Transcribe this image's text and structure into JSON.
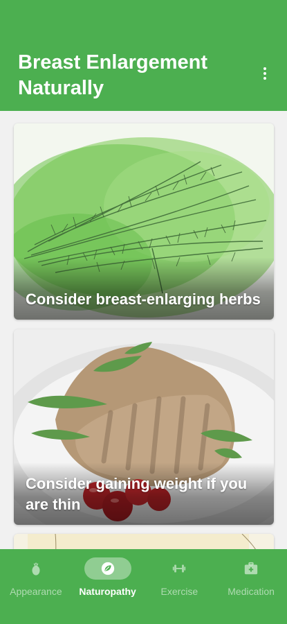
{
  "app_bar": {
    "title": "Breast Enlargement Naturally",
    "menu_icon": "more-vert-icon"
  },
  "articles": [
    {
      "title": "Consider breast-enlarging herbs",
      "image": "dill-herb-illustration"
    },
    {
      "title": "Consider gaining weight if you are thin",
      "image": "grilled-steak-plate-illustration"
    },
    {
      "title": "",
      "image": "partial-card-illustration"
    }
  ],
  "bottom_nav": {
    "items": [
      {
        "label": "Appearance",
        "icon": "pineapple-icon",
        "active": false
      },
      {
        "label": "Naturopathy",
        "icon": "leaf-icon",
        "active": true
      },
      {
        "label": "Exercise",
        "icon": "dumbbell-icon",
        "active": false
      },
      {
        "label": "Medication",
        "icon": "medical-kit-icon",
        "active": false
      }
    ]
  },
  "colors": {
    "primary": "#4caf50",
    "background": "#f1f1f1",
    "on_primary": "#ffffff"
  }
}
